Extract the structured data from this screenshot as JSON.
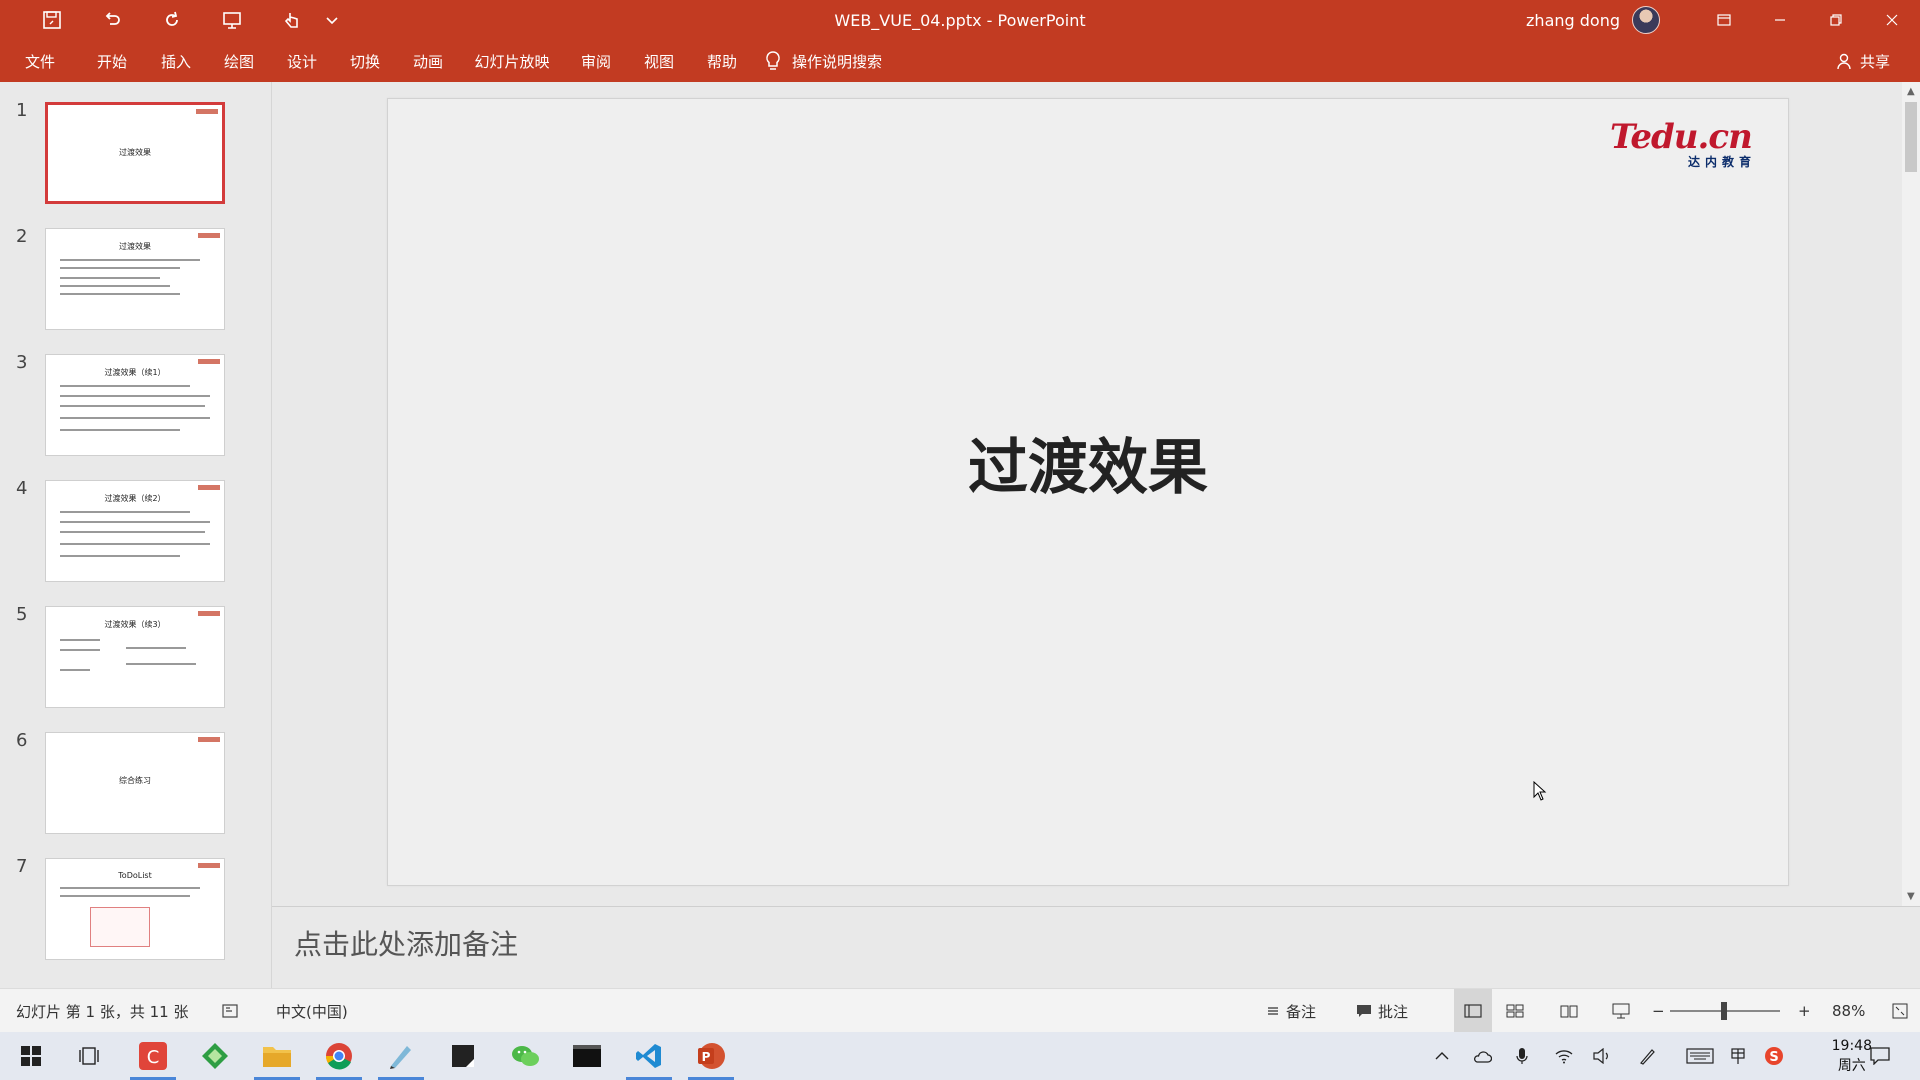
{
  "window": {
    "title": "WEB_VUE_04.pptx  -  PowerPoint",
    "user_name": "zhang dong"
  },
  "ribbon": {
    "tabs": [
      "文件",
      "开始",
      "插入",
      "绘图",
      "设计",
      "切换",
      "动画",
      "幻灯片放映",
      "审阅",
      "视图",
      "帮助"
    ],
    "tell_me": "操作说明搜索",
    "share": "共享"
  },
  "thumbnails": [
    {
      "num": "1",
      "title": "过渡效果"
    },
    {
      "num": "2",
      "title": "过渡效果"
    },
    {
      "num": "3",
      "title": "过渡效果（续1）"
    },
    {
      "num": "4",
      "title": "过渡效果（续2）"
    },
    {
      "num": "5",
      "title": "过渡效果（续3）"
    },
    {
      "num": "6",
      "title": "综合练习"
    },
    {
      "num": "7",
      "title": "ToDoList"
    }
  ],
  "slide": {
    "title": "过渡效果",
    "logo_text": "Tedu.cn",
    "logo_sub": "达内教育"
  },
  "notes": {
    "placeholder": "点击此处添加备注"
  },
  "status": {
    "slide_info": "幻灯片 第 1 张，共 11 张",
    "language": "中文(中国)",
    "notes_btn": "备注",
    "comments_btn": "批注",
    "zoom": "88%",
    "zoom_minus": "−",
    "zoom_plus": "+"
  },
  "taskbar": {
    "time": "19:48",
    "day": "周六"
  },
  "colors": {
    "accent": "#c23b22"
  }
}
